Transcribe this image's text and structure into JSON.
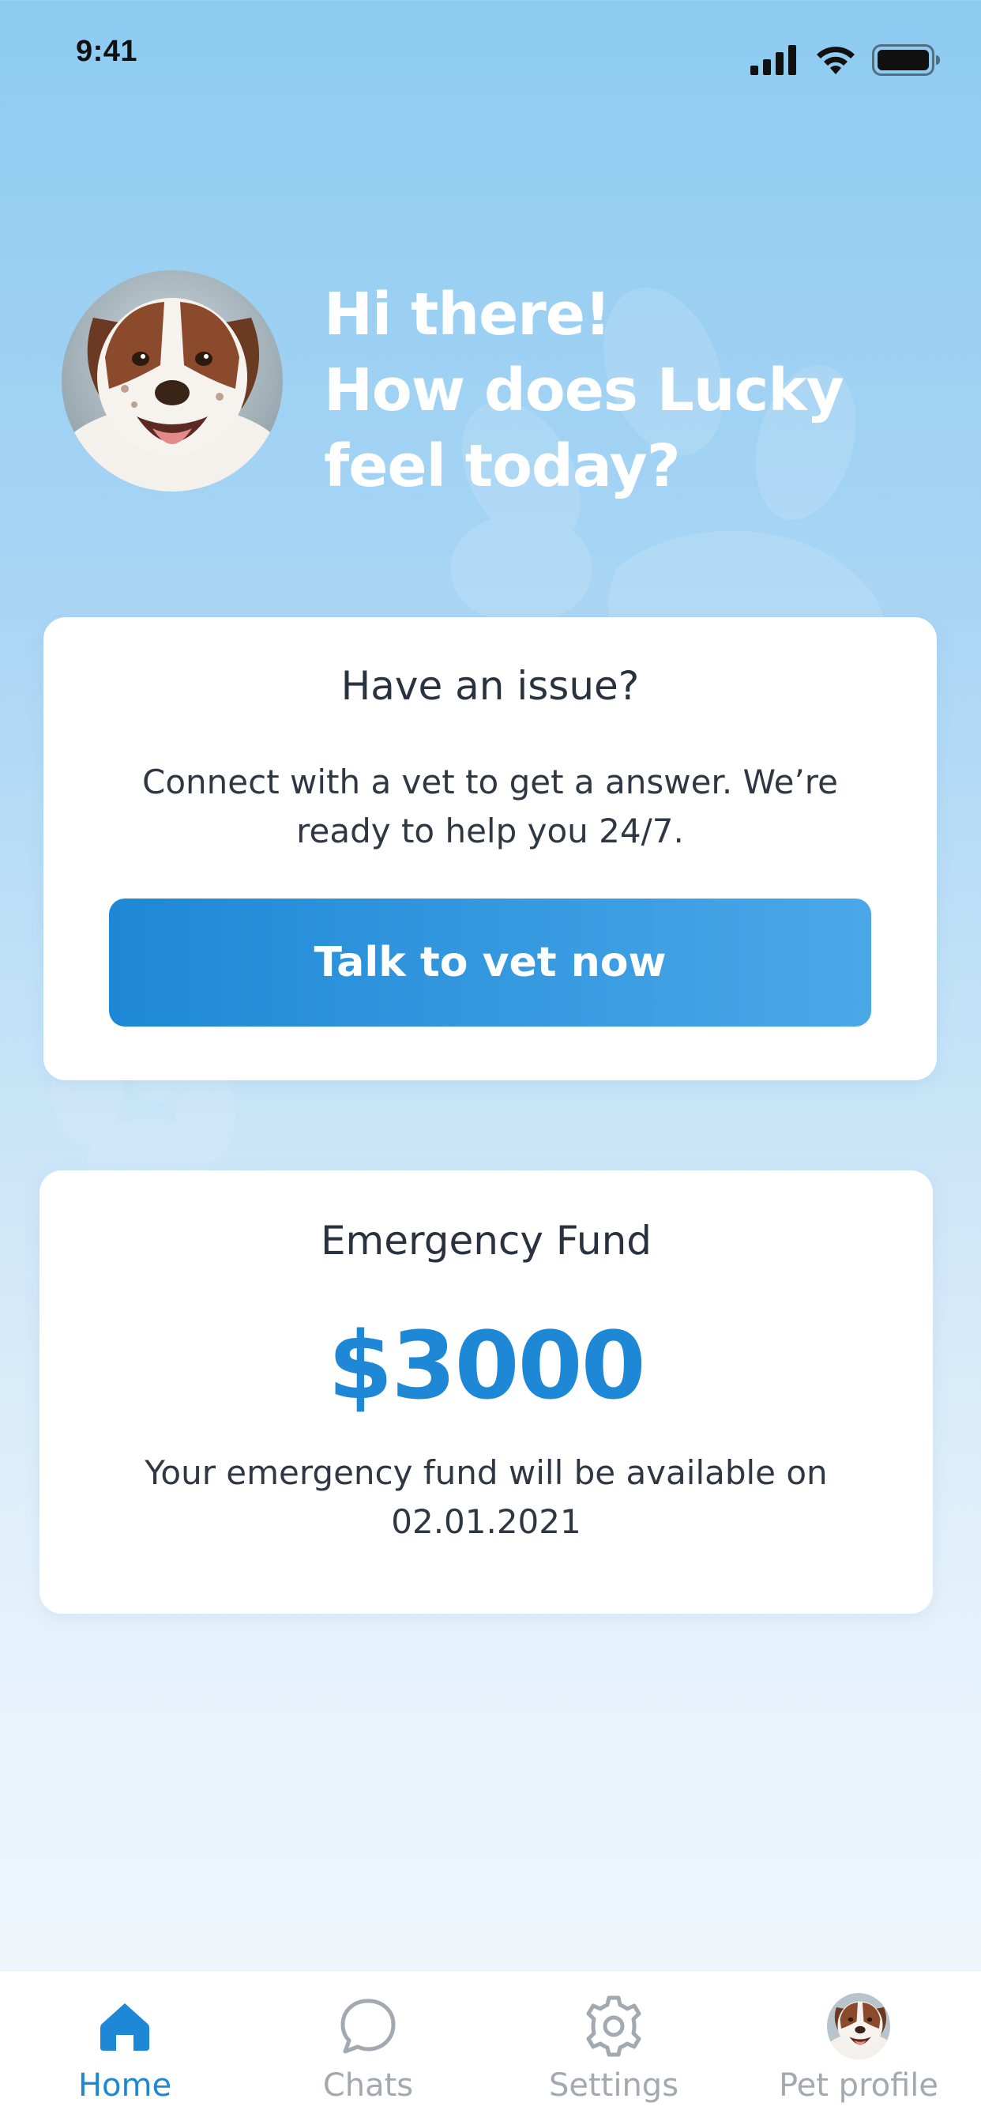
{
  "status_bar": {
    "time": "9:41"
  },
  "greeting": {
    "line1": "Hi there!",
    "line2": "How does Lucky",
    "line3": "feel today?"
  },
  "issue_card": {
    "title": "Have an issue?",
    "description": "Connect with a vet to get a answer. We’re ready to help you 24/7.",
    "button_label": "Talk to vet now"
  },
  "fund_card": {
    "title": "Emergency Fund",
    "amount": "$3000",
    "description": "Your emergency fund will be available on 02.01.2021"
  },
  "bottom_nav": {
    "items": [
      {
        "label": "Home",
        "icon": "home-icon",
        "active": true
      },
      {
        "label": "Chats",
        "icon": "chat-icon",
        "active": false
      },
      {
        "label": "Settings",
        "icon": "gear-icon",
        "active": false
      },
      {
        "label": "Pet profile",
        "icon": "pet-avatar",
        "active": false
      }
    ]
  },
  "colors": {
    "accent": "#1e88d6",
    "inactive": "#a3a9b0",
    "text_dark": "#2a3240",
    "background_top": "#8ecbf1",
    "background_bottom": "#f3f8fd"
  }
}
